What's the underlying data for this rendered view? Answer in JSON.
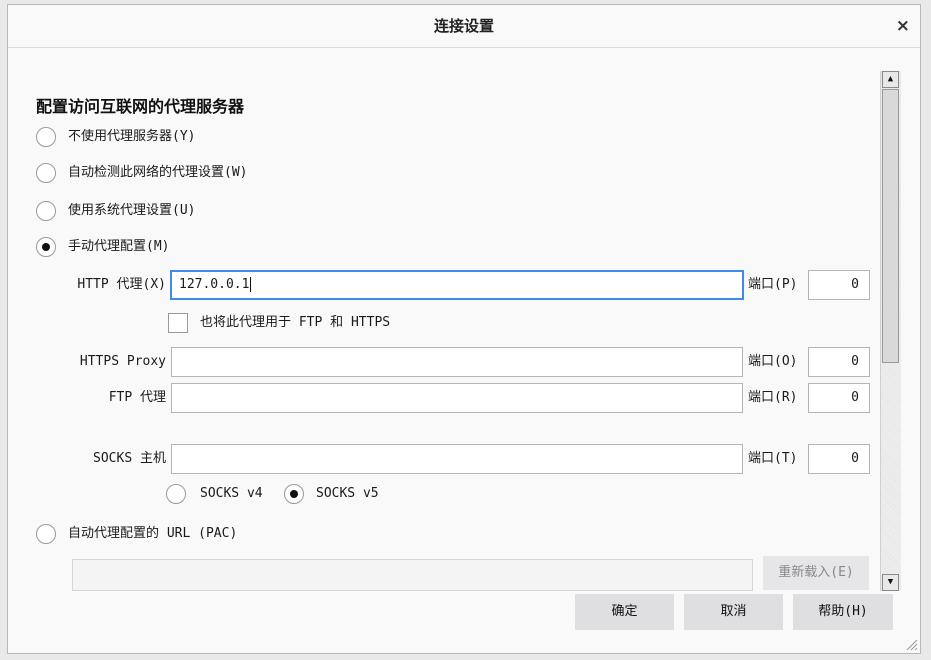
{
  "dialog": {
    "title": "连接设置",
    "close_label": "×"
  },
  "section_title": "配置访问互联网的代理服务器",
  "radios": {
    "no_proxy": {
      "label": "不使用代理服务器(Y)",
      "checked": false
    },
    "auto_detect": {
      "label": "自动检测此网络的代理设置(W)",
      "checked": false
    },
    "system_proxy": {
      "label": "使用系统代理设置(U)",
      "checked": false
    },
    "manual": {
      "label": "手动代理配置(M)",
      "checked": true
    },
    "pac": {
      "label": "自动代理配置的 URL (PAC)",
      "checked": false
    }
  },
  "http": {
    "label": "HTTP 代理(X)",
    "value": "127.0.0.1",
    "port_label": "端口(P)",
    "port": "0"
  },
  "also_use_checkbox": {
    "label": "也将此代理用于 FTP 和 HTTPS",
    "checked": false
  },
  "https": {
    "label": "HTTPS Proxy",
    "value": "",
    "port_label": "端口(O)",
    "port": "0"
  },
  "ftp": {
    "label": "FTP 代理",
    "value": "",
    "port_label": "端口(R)",
    "port": "0"
  },
  "socks": {
    "label": "SOCKS 主机",
    "value": "",
    "port_label": "端口(T)",
    "port": "0",
    "v4_label": "SOCKS v4",
    "v4_checked": false,
    "v5_label": "SOCKS v5",
    "v5_checked": true
  },
  "pac_url": {
    "value": "",
    "reload_label": "重新载入(E)"
  },
  "footer": {
    "ok_label": "确定",
    "cancel_label": "取消",
    "help_label": "帮助(H)"
  },
  "scrollbar": {
    "up_icon": "▲",
    "down_icon": "▼"
  }
}
